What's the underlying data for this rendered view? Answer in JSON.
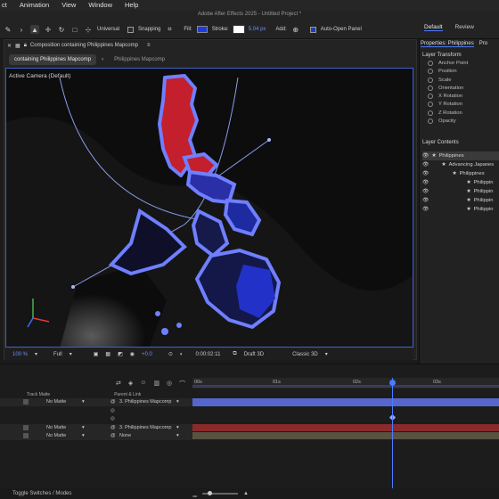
{
  "menu": [
    "ct",
    "Animation",
    "View",
    "Window",
    "Help"
  ],
  "app_title": "Adobe After Effects 2025 - Untitled Project *",
  "toolbar": {
    "universal_label": "Universal",
    "snapping_label": "Snapping",
    "fill_label": "Fill:",
    "stroke_label": "Stroke:",
    "stroke_width": "5.04 px",
    "add_label": "Add:",
    "auto_open_label": "Auto-Open Panel",
    "fill_color": "#1f3bdc"
  },
  "workspace_tabs": [
    "Default",
    "Review"
  ],
  "composition": {
    "panel_title": "Composition containing Philippines Mapcomp",
    "tab_active": "containing Philippines Mapcomp",
    "tab_other": "Philippines Mapcomp",
    "camera_label": "Active Camera (Default)",
    "zoom": "100 %",
    "resolution": "Full",
    "exposure": "+0.0",
    "timecode": "0:00:02:11",
    "draft": "Draft 3D",
    "renderer": "Classic 3D"
  },
  "properties": {
    "title": "Properties: Philippines",
    "title_cut": "Pro",
    "layer_transform": "Layer Transform",
    "transform_items": [
      "Anchor Point",
      "Position",
      "Scale",
      "Orientation",
      "X Rotation",
      "Y Rotation",
      "Z Rotation",
      "Opacity"
    ],
    "layer_contents": "Layer Contents",
    "contents": [
      {
        "label": "Philippines",
        "indent": 0
      },
      {
        "label": "Advancing Japanes",
        "indent": 1
      },
      {
        "label": "Philippines",
        "indent": 2
      },
      {
        "label": "Philippin",
        "indent": 3
      },
      {
        "label": "Philippin",
        "indent": 3
      },
      {
        "label": "Philippin",
        "indent": 3
      },
      {
        "label": "Philippin",
        "indent": 3
      }
    ]
  },
  "timeline": {
    "track_matte_header": "Track Matte",
    "parent_header": "Parent & Link",
    "ruler_ticks": [
      "00s",
      "01s",
      "02s",
      "03s"
    ],
    "rows": [
      {
        "matte": "No Matte",
        "parent": "3. Philippines Mapcomp"
      },
      {
        "matte": "No Matte",
        "parent": "3. Philippines Mapcomp"
      },
      {
        "matte": "No Matte",
        "parent": "None"
      }
    ],
    "toggle_label": "Toggle Switches / Modes"
  }
}
